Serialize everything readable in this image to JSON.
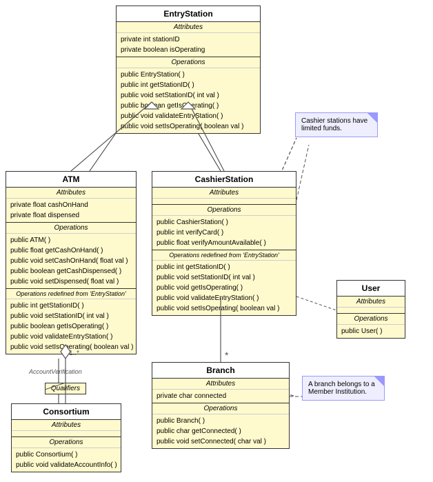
{
  "classes": {
    "entryStation": {
      "name": "EntryStation",
      "attributes_label": "Attributes",
      "attributes": [
        "private int stationID",
        "private boolean isOperating"
      ],
      "operations_label": "Operations",
      "operations": [
        "public EntryStation( )",
        "public int  getStationID( )",
        "public void  setStationID( int val )",
        "public boolean  getIsOperating( )",
        "public void  validateEntryStation( )",
        "public void  setIsOperating( boolean val )"
      ]
    },
    "atm": {
      "name": "ATM",
      "attributes_label": "Attributes",
      "attributes": [
        "private float cashOnHand",
        "private float dispensed"
      ],
      "operations_label": "Operations",
      "operations": [
        "public ATM( )",
        "public float  getCashOnHand( )",
        "public void  setCashOnHand( float val )",
        "public boolean  getCashDispensed( )",
        "public void  setDispensed( float val )"
      ],
      "redefined_label": "Operations redefined from 'EntryStation'",
      "redefined": [
        "public int  getStationID( )",
        "public void  setStationID( int val )",
        "public boolean  getIsOperating( )",
        "public void  validateEntryStation( )",
        "public void  setIsOperating( boolean val )"
      ]
    },
    "cashierStation": {
      "name": "CashierStation",
      "attributes_label": "Attributes",
      "operations_label": "Operations",
      "operations": [
        "public CashierStation( )",
        "public int  verifyCard( )",
        "public float  verifyAmountAvailable( )"
      ],
      "redefined_label": "Operations redefined from 'EntryStation'",
      "redefined": [
        "public int  getStationID( )",
        "public void  setStationID( int val )",
        "public void  getIsOperating( )",
        "public void  validateEntryStation( )",
        "public void  setIsOperating( boolean val )"
      ]
    },
    "user": {
      "name": "User",
      "attributes_label": "Attributes",
      "operations_label": "Operations",
      "operations": [
        "public User( )"
      ]
    },
    "branch": {
      "name": "Branch",
      "attributes_label": "Attributes",
      "attributes": [
        "private char connected"
      ],
      "operations_label": "Operations",
      "operations": [
        "public Branch( )",
        "public char  getConnected( )",
        "public void  setConnected( char val )"
      ]
    },
    "consortium": {
      "name": "Consortium",
      "attributes_label": "Attributes",
      "operations_label": "Operations",
      "operations": [
        "public Consortium( )",
        "public void  validateAccountInfo( )"
      ]
    }
  },
  "notes": {
    "cashier": "Cashier stations have limited funds.",
    "branch": "A branch belongs to a Member Institution."
  },
  "qualifiers": {
    "label": "Qualifiers"
  },
  "labels": {
    "accountVerification": "AccountVerification",
    "multiplicity": "1..*"
  }
}
